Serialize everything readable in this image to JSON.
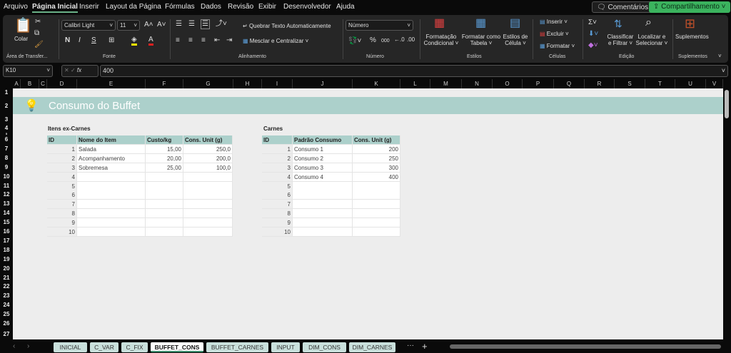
{
  "menu": [
    "Arquivo",
    "Página Inicial",
    "Inserir",
    "Layout da Página",
    "Fórmulas",
    "Dados",
    "Revisão",
    "Exibir",
    "Desenvolvedor",
    "Ajuda"
  ],
  "active_menu": "Página Inicial",
  "comments_label": "Comentários",
  "share_label": "Compartilhamento",
  "share_color": "#3bb35e",
  "ribbon": {
    "paste": "Colar",
    "clipboard": "Área de Transfer...",
    "font_name": "Calibri Light",
    "font_size": "11",
    "bold": "N",
    "italic": "I",
    "underline": "S",
    "font_group": "Fonte",
    "wrap": "Quebrar Texto Automaticamente",
    "merge": "Mesclar e Centralizar",
    "align_group": "Alinhamento",
    "number_format": "Número",
    "number_group": "Número",
    "percent": "%",
    "thousands": "000",
    "cond_format": [
      "Formatação",
      "Condicional ˅"
    ],
    "format_table": [
      "Formatar como",
      "Tabela ˅"
    ],
    "cell_styles": [
      "Estilos de",
      "Célula ˅"
    ],
    "styles_group": "Estilos",
    "insert": "Inserir",
    "delete": "Excluir",
    "format": "Formatar",
    "cells_group": "Células",
    "sort": [
      "Classificar",
      "e Filtrar ˅"
    ],
    "find": [
      "Localizar e",
      "Selecionar ˅"
    ],
    "edit_group": "Edição",
    "addins": "Suplementos",
    "addins_group": "Suplementos"
  },
  "formula": {
    "name_box": "K10",
    "fx": "fx",
    "value": "400"
  },
  "columns": [
    "A",
    "B",
    "C",
    "D",
    "E",
    "F",
    "G",
    "H",
    "I",
    "J",
    "K",
    "L",
    "M",
    "N",
    "O",
    "P",
    "Q",
    "R",
    "S",
    "T",
    "U",
    "V"
  ],
  "rows": [
    "1",
    "2",
    "3",
    "4",
    "5",
    "6",
    "7",
    "8",
    "9",
    "10",
    "11",
    "12",
    "13",
    "14",
    "15",
    "16",
    "17",
    "18",
    "19",
    "20",
    "21",
    "22",
    "23",
    "24",
    "25",
    "26",
    "27"
  ],
  "sheet": {
    "title": "Consumo do Buffet",
    "accent": "#acd0cb",
    "t1": {
      "caption": "Itens ex-Carnes",
      "headers": [
        "ID",
        "Nome do Item",
        "Custo/kg",
        "Cons. Unit (g)"
      ],
      "rows": [
        [
          "1",
          "Salada",
          "15,00",
          "250,0"
        ],
        [
          "2",
          "Acompanhamento",
          "20,00",
          "200,0"
        ],
        [
          "3",
          "Sobremesa",
          "25,00",
          "100,0"
        ],
        [
          "4",
          "",
          "",
          ""
        ],
        [
          "5",
          "",
          "",
          ""
        ],
        [
          "6",
          "",
          "",
          ""
        ],
        [
          "7",
          "",
          "",
          ""
        ],
        [
          "8",
          "",
          "",
          ""
        ],
        [
          "9",
          "",
          "",
          ""
        ],
        [
          "10",
          "",
          "",
          ""
        ]
      ]
    },
    "t2": {
      "caption": "Carnes",
      "headers": [
        "ID",
        "Padrão Consumo",
        "Cons. Unit (g)"
      ],
      "rows": [
        [
          "1",
          "Consumo 1",
          "200"
        ],
        [
          "2",
          "Consumo 2",
          "250"
        ],
        [
          "3",
          "Consumo 3",
          "300"
        ],
        [
          "4",
          "Consumo 4",
          "400"
        ],
        [
          "5",
          "",
          ""
        ],
        [
          "6",
          "",
          ""
        ],
        [
          "7",
          "",
          ""
        ],
        [
          "8",
          "",
          ""
        ],
        [
          "9",
          "",
          ""
        ],
        [
          "10",
          "",
          ""
        ]
      ]
    }
  },
  "tabs": [
    "INICIAL",
    "C_VAR",
    "C_FIX",
    "BUFFET_CONS",
    "BUFFET_CARNES",
    "INPUT",
    "DIM_CONS",
    "DIM_CARNES"
  ],
  "active_tab": "BUFFET_CONS"
}
